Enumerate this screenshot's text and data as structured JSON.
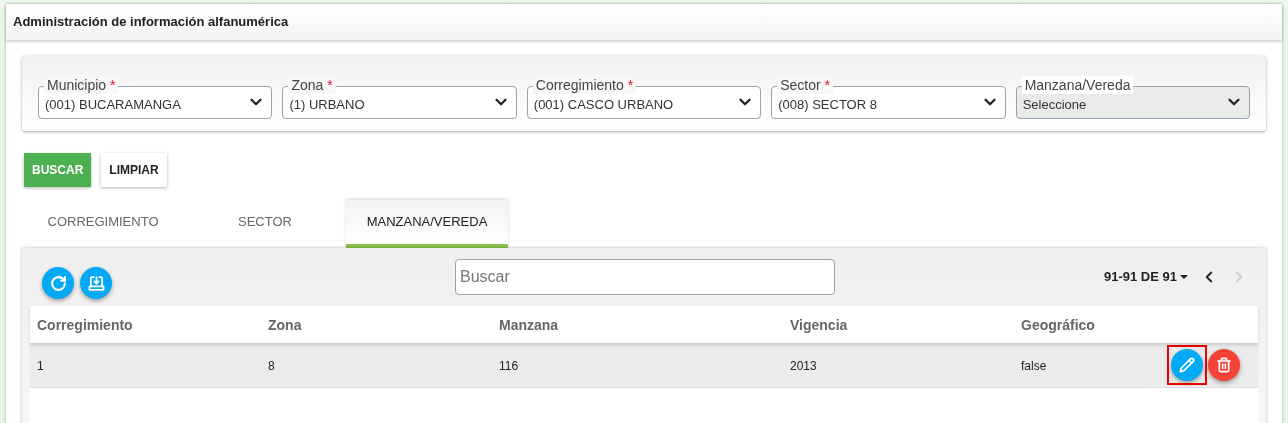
{
  "title": "Administración de información alfanumérica",
  "filters": [
    {
      "label": "Municipio",
      "required": true,
      "value": "(001) BUCARAMANGA",
      "highlighted": false
    },
    {
      "label": "Zona",
      "required": true,
      "value": "(1) URBANO",
      "highlighted": false
    },
    {
      "label": "Corregimiento",
      "required": true,
      "value": "(001) CASCO URBANO",
      "highlighted": false
    },
    {
      "label": "Sector",
      "required": true,
      "value": "(008) SECTOR 8",
      "highlighted": false
    },
    {
      "label": "Manzana/Vereda",
      "required": false,
      "value": "Seleccione",
      "highlighted": true
    }
  ],
  "required_mark": "*",
  "buttons": [
    {
      "label": "BUSCAR",
      "kind": "primary"
    },
    {
      "label": "LIMPIAR",
      "kind": "plain"
    }
  ],
  "tabs": [
    {
      "label": "CORREGIMIENTO",
      "selected": false
    },
    {
      "label": "SECTOR",
      "selected": false
    },
    {
      "label": "MANZANA/VEREDA",
      "selected": true
    }
  ],
  "table": {
    "search": {
      "placeholder": "Buscar"
    },
    "pagination": {
      "label": "91-91 DE 91",
      "prev_disabled": false,
      "next_disabled": true
    },
    "columns": [
      "Corregimiento",
      "Zona",
      "Manzana",
      "Vigencia",
      "Geográfico"
    ],
    "rows": [
      {
        "cells": [
          "1",
          "8",
          "116",
          "2013",
          "false"
        ],
        "actions": [
          {
            "kind": "edit",
            "highlighted": true
          },
          {
            "kind": "delete",
            "highlighted": false
          }
        ]
      }
    ]
  }
}
